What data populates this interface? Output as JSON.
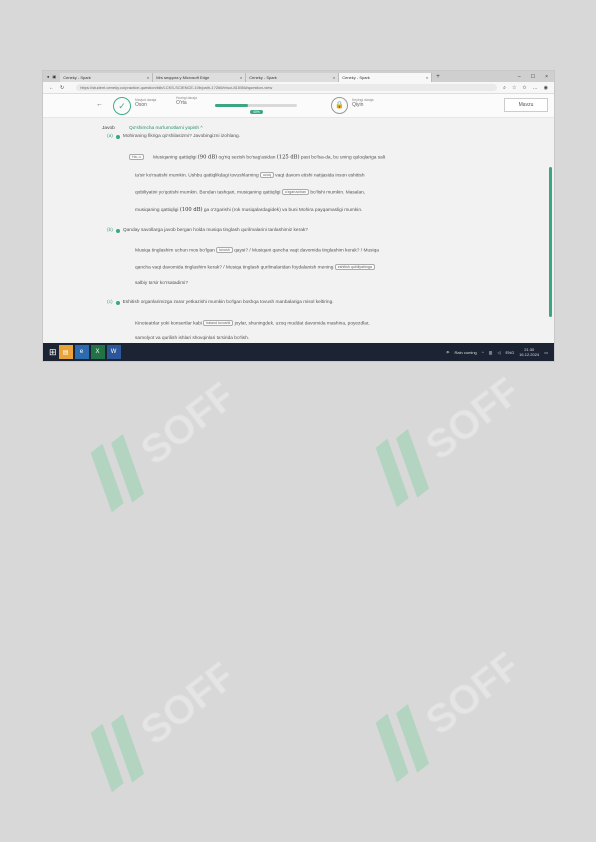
{
  "browser": {
    "tabs": [
      {
        "label": "Ceneky - Spark"
      },
      {
        "label": "Mrs seqqora y Microsoft Edge"
      },
      {
        "label": "Ceneky - Spark"
      },
      {
        "label": "Ceneky - Spark"
      }
    ],
    "url": "https://student.ceneky.co/practice-question/tdb/LCKS-SCIENCE-10b/path-1?266/tr/sci-815/56#question-view"
  },
  "header": {
    "step1_label": "Mavjud daraja",
    "step1_value": "Oson",
    "step2_label": "Hozirgi daraja",
    "step2_value": "O'rta",
    "progress_percent": 40,
    "progress_label": "40%",
    "step3_label": "Keyingi daraja",
    "step3_value": "Qiyin",
    "mavzu_button": "Mavzu"
  },
  "content": {
    "javob_label": "Javob",
    "qoshimcha_label": "Qo'shimcha ma'lumotlarni yopish ^",
    "items": [
      {
        "letter": "(a)",
        "question": "Mohiraning fikriga qo'shilasizmi? Javobingizni izohlang.",
        "sel1": "Ha, u",
        "l1_a": "Musiqaning qattiqligi",
        "l1_num1": "(90 dB)",
        "l1_b": "og'riq sezish bo'sag'asidan",
        "l1_num2": "(125 dB)",
        "l1_c": "past bo'lsa-da, bu uning quloqlariga salt",
        "l2_a": "ta'sir ko'rsatishi mumkin. Ushbu qattiqlikdagi tovushlarning",
        "sel2": "uzoq",
        "l2_b": "vaqt davom etishi natijasida inson eshitish",
        "l3_a": "qobiliyatini yo'qotishi mumkin. Bundan tashqari, musiqaning qattiqligi",
        "sel3": "o'zgaruvchan",
        "l3_b": "bo'lishi mumkin. Masalan,",
        "l4_a": "musiqaning qattiqligi",
        "l4_num": "(100 dB)",
        "l4_b": "ga o'zgarishi (rok musiqalardagidek) va buni Mohira payqamasligi mumkin."
      },
      {
        "letter": "(b)",
        "question": "Qanday savollarga javob bergan holda musiqa tinglash qurilmalarini tanlashimiz kerak?",
        "l1_a": "Musiqa tinglashim uchun mos bo'lgan",
        "sel1": "tovush",
        "l1_b": "qaysi? / Musiqani qancha vaqt davomida tinglashim kerak? / Musiqa",
        "l2_a": "qancha vaqt davomida tinglashim kerak? / Musiqa tinglash qurilmalaridan foydalanish mening",
        "sel2": "eshitish qobiliyatimga",
        "l3_a": "salbiy ta'sir ko'rsatadimi?"
      },
      {
        "letter": "(c)",
        "question": "Eshitish organlarimizga zarar yetkazishi mumkin bo'lgan boshqa tovush manbalariga misol keltiring.",
        "l1_a": "Kinoteatrlar yoki konsertlar kabi",
        "sel1": "baland tovushli",
        "l1_b": "joylar, shuningdek, uzoq muddat davomida mashina, poyezdlar,",
        "l2_a": "samolyot va qurilish ishlari shovqinlari ta'sirida bo'lish."
      }
    ]
  },
  "taskbar": {
    "weather": "Rain coming",
    "lang": "ENG",
    "time": "21:30",
    "date": "16.12.2024"
  },
  "watermark": {
    "text": "SOFF"
  },
  "colors": {
    "accent": "#3aa682",
    "watermark": "#6fcf97",
    "taskbar": "#1c2434"
  }
}
